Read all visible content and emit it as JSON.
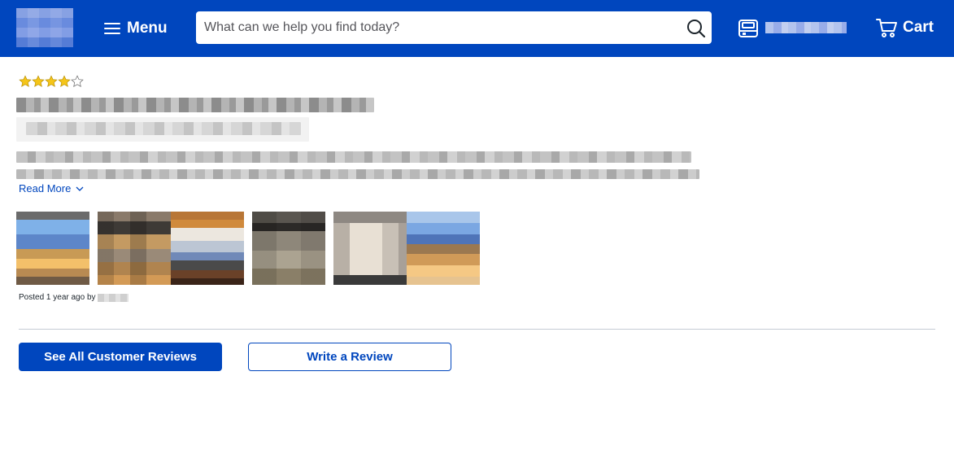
{
  "header": {
    "logo": "brand-logo",
    "menu_label": "Menu",
    "search_placeholder": "What can we help you find today?",
    "search_value": "",
    "cart_label": "Cart",
    "brand_color": "#0046be"
  },
  "review": {
    "rating": 4,
    "rating_max": 5,
    "read_more_label": "Read More",
    "photo_count": 6,
    "posted_text": "Posted 1 year ago by"
  },
  "actions": {
    "see_all_label": "See All Customer Reviews",
    "write_review_label": "Write a Review"
  }
}
